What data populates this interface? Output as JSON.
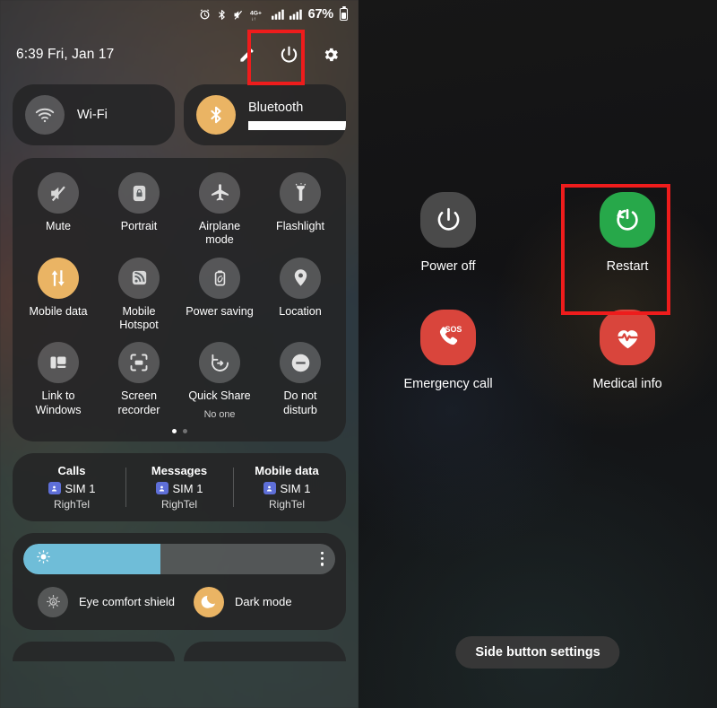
{
  "left_panel": {
    "statusbar": {
      "icons": [
        "alarm-icon",
        "bluetooth-icon",
        "mute-icon",
        "network-4gplus-icon",
        "signal-sim1-icon",
        "signal-sim2-icon"
      ],
      "network_label": "4G+",
      "battery_percent": "67%"
    },
    "header": {
      "clock": "6:39  Fri, Jan 17",
      "actions": [
        "edit-pencil-icon",
        "power-icon",
        "settings-gear-icon"
      ]
    },
    "top_tiles": [
      {
        "label": "Wi-Fi",
        "icon": "wifi-icon",
        "state": "off",
        "redacted": false
      },
      {
        "label": "Bluetooth",
        "icon": "bluetooth-icon",
        "state": "on",
        "redacted": true
      }
    ],
    "grid_tiles": [
      {
        "label": "Mute",
        "icon": "mute-icon",
        "state": "off",
        "sub": ""
      },
      {
        "label": "Portrait",
        "icon": "rotation-lock-icon",
        "state": "off",
        "sub": ""
      },
      {
        "label": "Airplane mode",
        "icon": "airplane-icon",
        "state": "off",
        "sub": ""
      },
      {
        "label": "Flashlight",
        "icon": "flashlight-icon",
        "state": "off",
        "sub": ""
      },
      {
        "label": "Mobile data",
        "icon": "mobile-data-icon",
        "state": "on",
        "sub": ""
      },
      {
        "label": "Mobile Hotspot",
        "icon": "hotspot-icon",
        "state": "off",
        "sub": ""
      },
      {
        "label": "Power saving",
        "icon": "battery-leaf-icon",
        "state": "off",
        "sub": ""
      },
      {
        "label": "Location",
        "icon": "location-pin-icon",
        "state": "off",
        "sub": ""
      },
      {
        "label": "Link to Windows",
        "icon": "link-to-windows-icon",
        "state": "off",
        "sub": ""
      },
      {
        "label": "Screen recorder",
        "icon": "screen-recorder-icon",
        "state": "off",
        "sub": ""
      },
      {
        "label": "Quick Share",
        "icon": "quick-share-icon",
        "state": "off",
        "sub": "No one"
      },
      {
        "label": "Do not disturb",
        "icon": "do-not-disturb-icon",
        "state": "off",
        "sub": ""
      }
    ],
    "page_indicator": {
      "total": 2,
      "active": 1
    },
    "sim_row": [
      {
        "title": "Calls",
        "sim": "SIM 1",
        "carrier": "RighTel"
      },
      {
        "title": "Messages",
        "sim": "SIM 1",
        "carrier": "RighTel"
      },
      {
        "title": "Mobile data",
        "sim": "SIM 1",
        "carrier": "RighTel"
      }
    ],
    "brightness": {
      "value_percent": 44,
      "icon": "brightness-sun-icon",
      "menu_icon": "kebab-menu-icon"
    },
    "display_toggles": [
      {
        "label": "Eye comfort shield",
        "icon": "eye-comfort-icon",
        "state": "off"
      },
      {
        "label": "Dark mode",
        "icon": "moon-icon",
        "state": "on"
      }
    ]
  },
  "right_panel": {
    "menu_items": [
      {
        "label": "Power off",
        "icon": "power-icon",
        "color": "#4a4a4a",
        "highlighted": false
      },
      {
        "label": "Restart",
        "icon": "restart-icon",
        "color": "#27a84a",
        "highlighted": true
      },
      {
        "label": "Emergency call",
        "icon": "sos-call-icon",
        "color": "#d9453c",
        "highlighted": false
      },
      {
        "label": "Medical info",
        "icon": "heart-pulse-icon",
        "color": "#d9453c",
        "highlighted": false
      }
    ],
    "side_button_settings": "Side button settings"
  },
  "colors": {
    "highlight_red": "#ee1c1c",
    "accent_on": "#eab464",
    "restart_green": "#27a84a",
    "emergency_red": "#d9453c",
    "slider_blue": "#6fbdd8"
  }
}
